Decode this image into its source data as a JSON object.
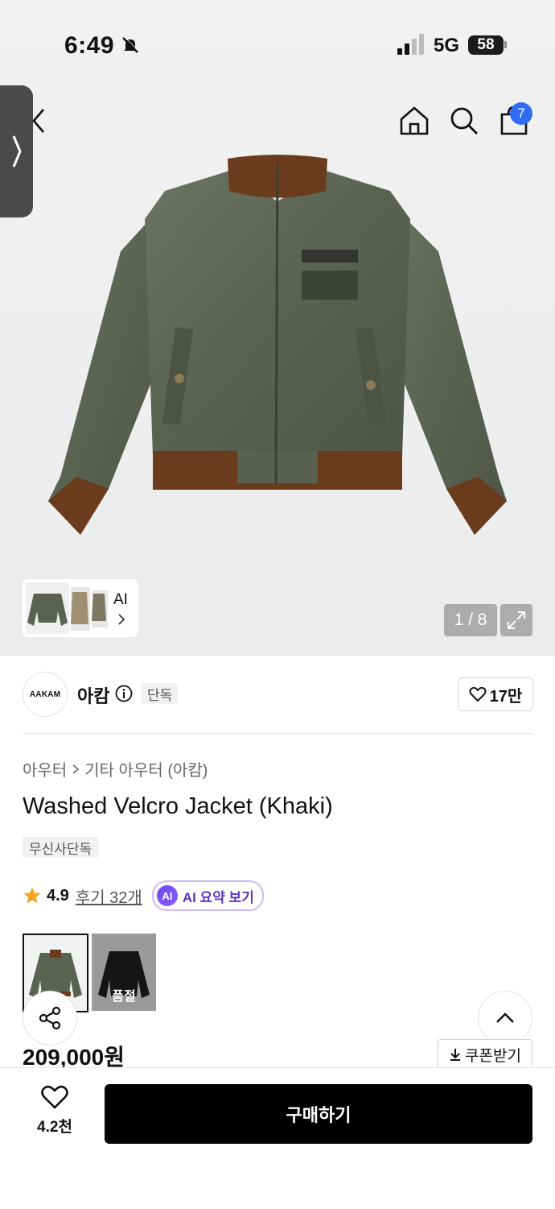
{
  "status_bar": {
    "time": "6:49",
    "network": "5G",
    "battery": "58"
  },
  "header": {
    "cart_count": "7"
  },
  "gallery": {
    "thumb_label": "AI",
    "pager": "1 / 8"
  },
  "brand": {
    "logo_text": "AAKAM",
    "name": "아캄",
    "exclusive_label": "단독",
    "likes": "17만"
  },
  "product": {
    "breadcrumb": [
      "아우터",
      "기타 아우터 (아캄)"
    ],
    "title": "Washed Velcro Jacket (Khaki)",
    "tag": "무신사단독",
    "rating": "4.9",
    "reviews": "후기 32개",
    "ai_summary": "AI 요약 보기",
    "ai_badge": "AI",
    "soldout_label": "품절",
    "price": "209,000원",
    "coupon_label": "쿠폰받기"
  },
  "bottom": {
    "like_count": "4.2천",
    "buy_label": "구매하기"
  },
  "colors": {
    "accent_blue": "#2f6df6",
    "ai_purple": "#5a36c9",
    "jacket_khaki": "#5c6452",
    "rib_brown": "#6a3b1c"
  }
}
